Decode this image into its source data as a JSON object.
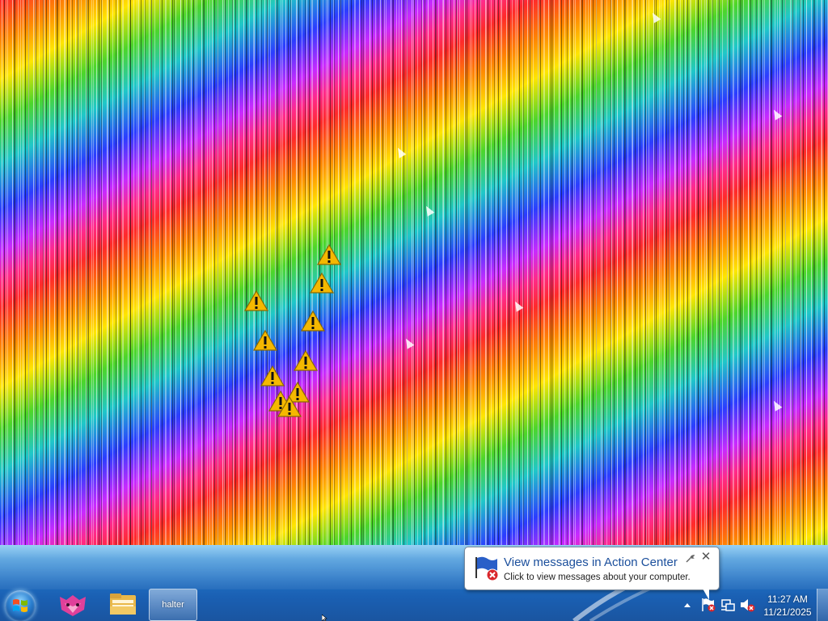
{
  "taskbar": {
    "start_button": "start-orb",
    "pinned": [
      {
        "name": "app-icon",
        "icon": "pink-fox-icon"
      },
      {
        "name": "windows-explorer",
        "icon": "folder-icon"
      }
    ],
    "active_window_label": "halter"
  },
  "notification": {
    "title": "View messages in Action Center",
    "text": "Click to view messages about your computer.",
    "close_glyph": "✕"
  },
  "tray": {
    "icons": [
      "show-hidden-icons-arrow",
      "action-center-flag-icon",
      "network-icon",
      "volume-muted-icon"
    ]
  },
  "clock": {
    "time": "11:27 AM",
    "date": "11/21/2025"
  },
  "desktop": {
    "warning_icon_count": 12
  },
  "colors": {
    "taskbar": "#1f6fc2",
    "balloon_title": "#1b4f9c",
    "warning": "#f5b800"
  }
}
